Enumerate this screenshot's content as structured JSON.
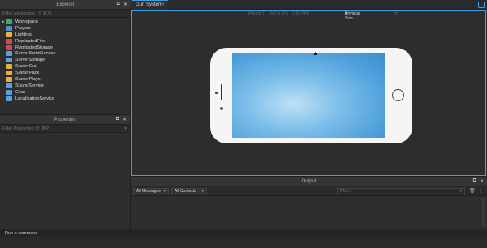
{
  "explorer": {
    "title": "Explorer",
    "filter_placeholder": "Filter workspace (⇧ ⌘X)",
    "items": [
      {
        "label": "Workspace",
        "icon": "workspace-icon",
        "color": "#3fae5a",
        "arrow": "▶"
      },
      {
        "label": "Players",
        "icon": "players-icon",
        "color": "#4a90d9",
        "arrow": ""
      },
      {
        "label": "Lighting",
        "icon": "lighting-icon",
        "color": "#e8b84a",
        "arrow": ""
      },
      {
        "label": "ReplicatedFirst",
        "icon": "replicated-first-icon",
        "color": "#d24a4a",
        "arrow": ""
      },
      {
        "label": "ReplicatedStorage",
        "icon": "replicated-storage-icon",
        "color": "#d24a4a",
        "arrow": ""
      },
      {
        "label": "ServerScriptService",
        "icon": "server-script-service-icon",
        "color": "#5aa0e0",
        "arrow": ""
      },
      {
        "label": "ServerStorage",
        "icon": "server-storage-icon",
        "color": "#5aa0e0",
        "arrow": ""
      },
      {
        "label": "StarterGui",
        "icon": "starter-gui-icon",
        "color": "#e0b040",
        "arrow": ""
      },
      {
        "label": "StarterPack",
        "icon": "starter-pack-icon",
        "color": "#e0b040",
        "arrow": ""
      },
      {
        "label": "StarterPlayer",
        "icon": "starter-player-icon",
        "color": "#e0b040",
        "arrow": ""
      },
      {
        "label": "SoundService",
        "icon": "sound-service-icon",
        "color": "#5aa0e0",
        "arrow": ""
      },
      {
        "label": "Chat",
        "icon": "chat-icon",
        "color": "#5aa0e0",
        "arrow": ""
      },
      {
        "label": "LocalizationService",
        "icon": "localization-service-icon",
        "color": "#5aa0e0",
        "arrow": ""
      }
    ]
  },
  "properties": {
    "title": "Properties",
    "filter_placeholder": "Filter Properties (⇧ ⌘P)"
  },
  "tabs": {
    "active_label": "Gun System",
    "close_glyph": "✕"
  },
  "viewport": {
    "device_name": "iPhone 7",
    "resolution": "667 x 375",
    "dpi": "(326 PPI)",
    "size_mode": "Physical Size",
    "orientation": "Landscape"
  },
  "output": {
    "title": "Output",
    "messages_filter": "All Messages",
    "contexts_filter": "All Contexts",
    "filter_placeholder": "Filter..."
  },
  "command_bar": {
    "placeholder": "Run a command"
  },
  "colors": {
    "accent": "#3aa0e8",
    "background": "#2e2e2e"
  }
}
